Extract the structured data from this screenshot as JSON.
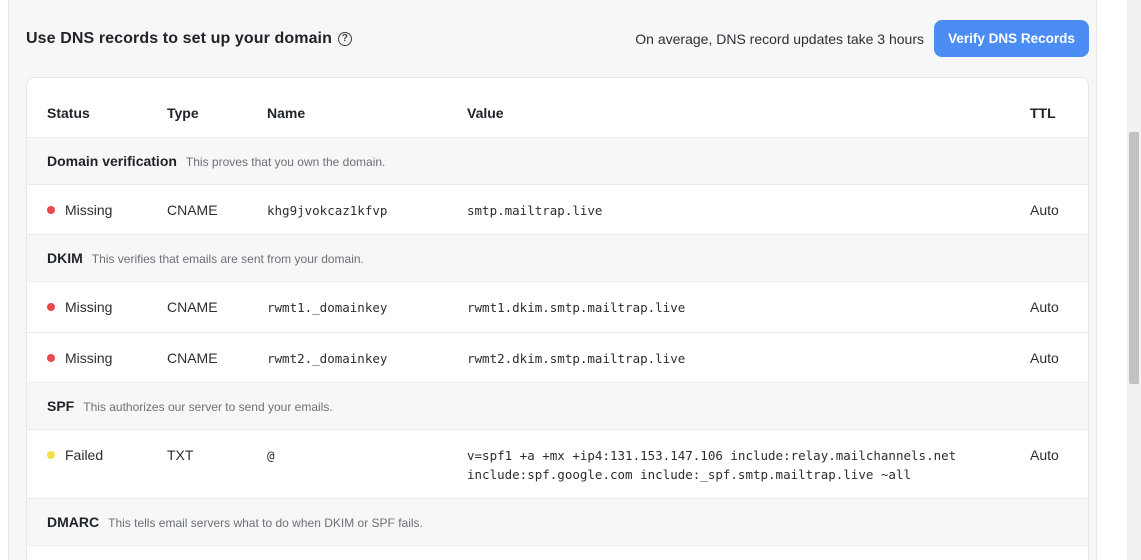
{
  "header": {
    "title": "Use DNS records to set up your domain",
    "note": "On average, DNS record updates take 3 hours",
    "verify_label": "Verify DNS Records"
  },
  "table": {
    "columns": {
      "status": "Status",
      "type": "Type",
      "name": "Name",
      "value": "Value",
      "ttl": "TTL"
    },
    "groups": {
      "domain": {
        "title": "Domain verification",
        "desc": "This proves that you own the domain."
      },
      "dkim": {
        "title": "DKIM",
        "desc": "This verifies that emails are sent from your domain."
      },
      "spf": {
        "title": "SPF",
        "desc": "This authorizes our server to send your emails."
      },
      "dmarc": {
        "title": "DMARC",
        "desc": "This tells email servers what to do when DKIM or SPF fails."
      }
    },
    "records": [
      {
        "status": "Missing",
        "type": "CNAME",
        "name": "khg9jvokcaz1kfvp",
        "value": "smtp.mailtrap.live",
        "ttl": "Auto"
      },
      {
        "status": "Missing",
        "type": "CNAME",
        "name": "rwmt1._domainkey",
        "value": "rwmt1.dkim.smtp.mailtrap.live",
        "ttl": "Auto"
      },
      {
        "status": "Missing",
        "type": "CNAME",
        "name": "rwmt2._domainkey",
        "value": "rwmt2.dkim.smtp.mailtrap.live",
        "ttl": "Auto"
      },
      {
        "status": "Failed",
        "type": "TXT",
        "name": "@",
        "value_line1": "v=spf1 +a +mx +ip4:131.153.147.106 include:relay.mailchannels.net",
        "value_line2": "include:spf.google.com include:_spf.smtp.mailtrap.live ~all",
        "ttl": "Auto"
      }
    ]
  },
  "colors": {
    "accent": "#4c8df5",
    "missing": "#e5484d",
    "failed": "#f2df4a"
  },
  "icons": {
    "help": "question-circle-icon"
  }
}
